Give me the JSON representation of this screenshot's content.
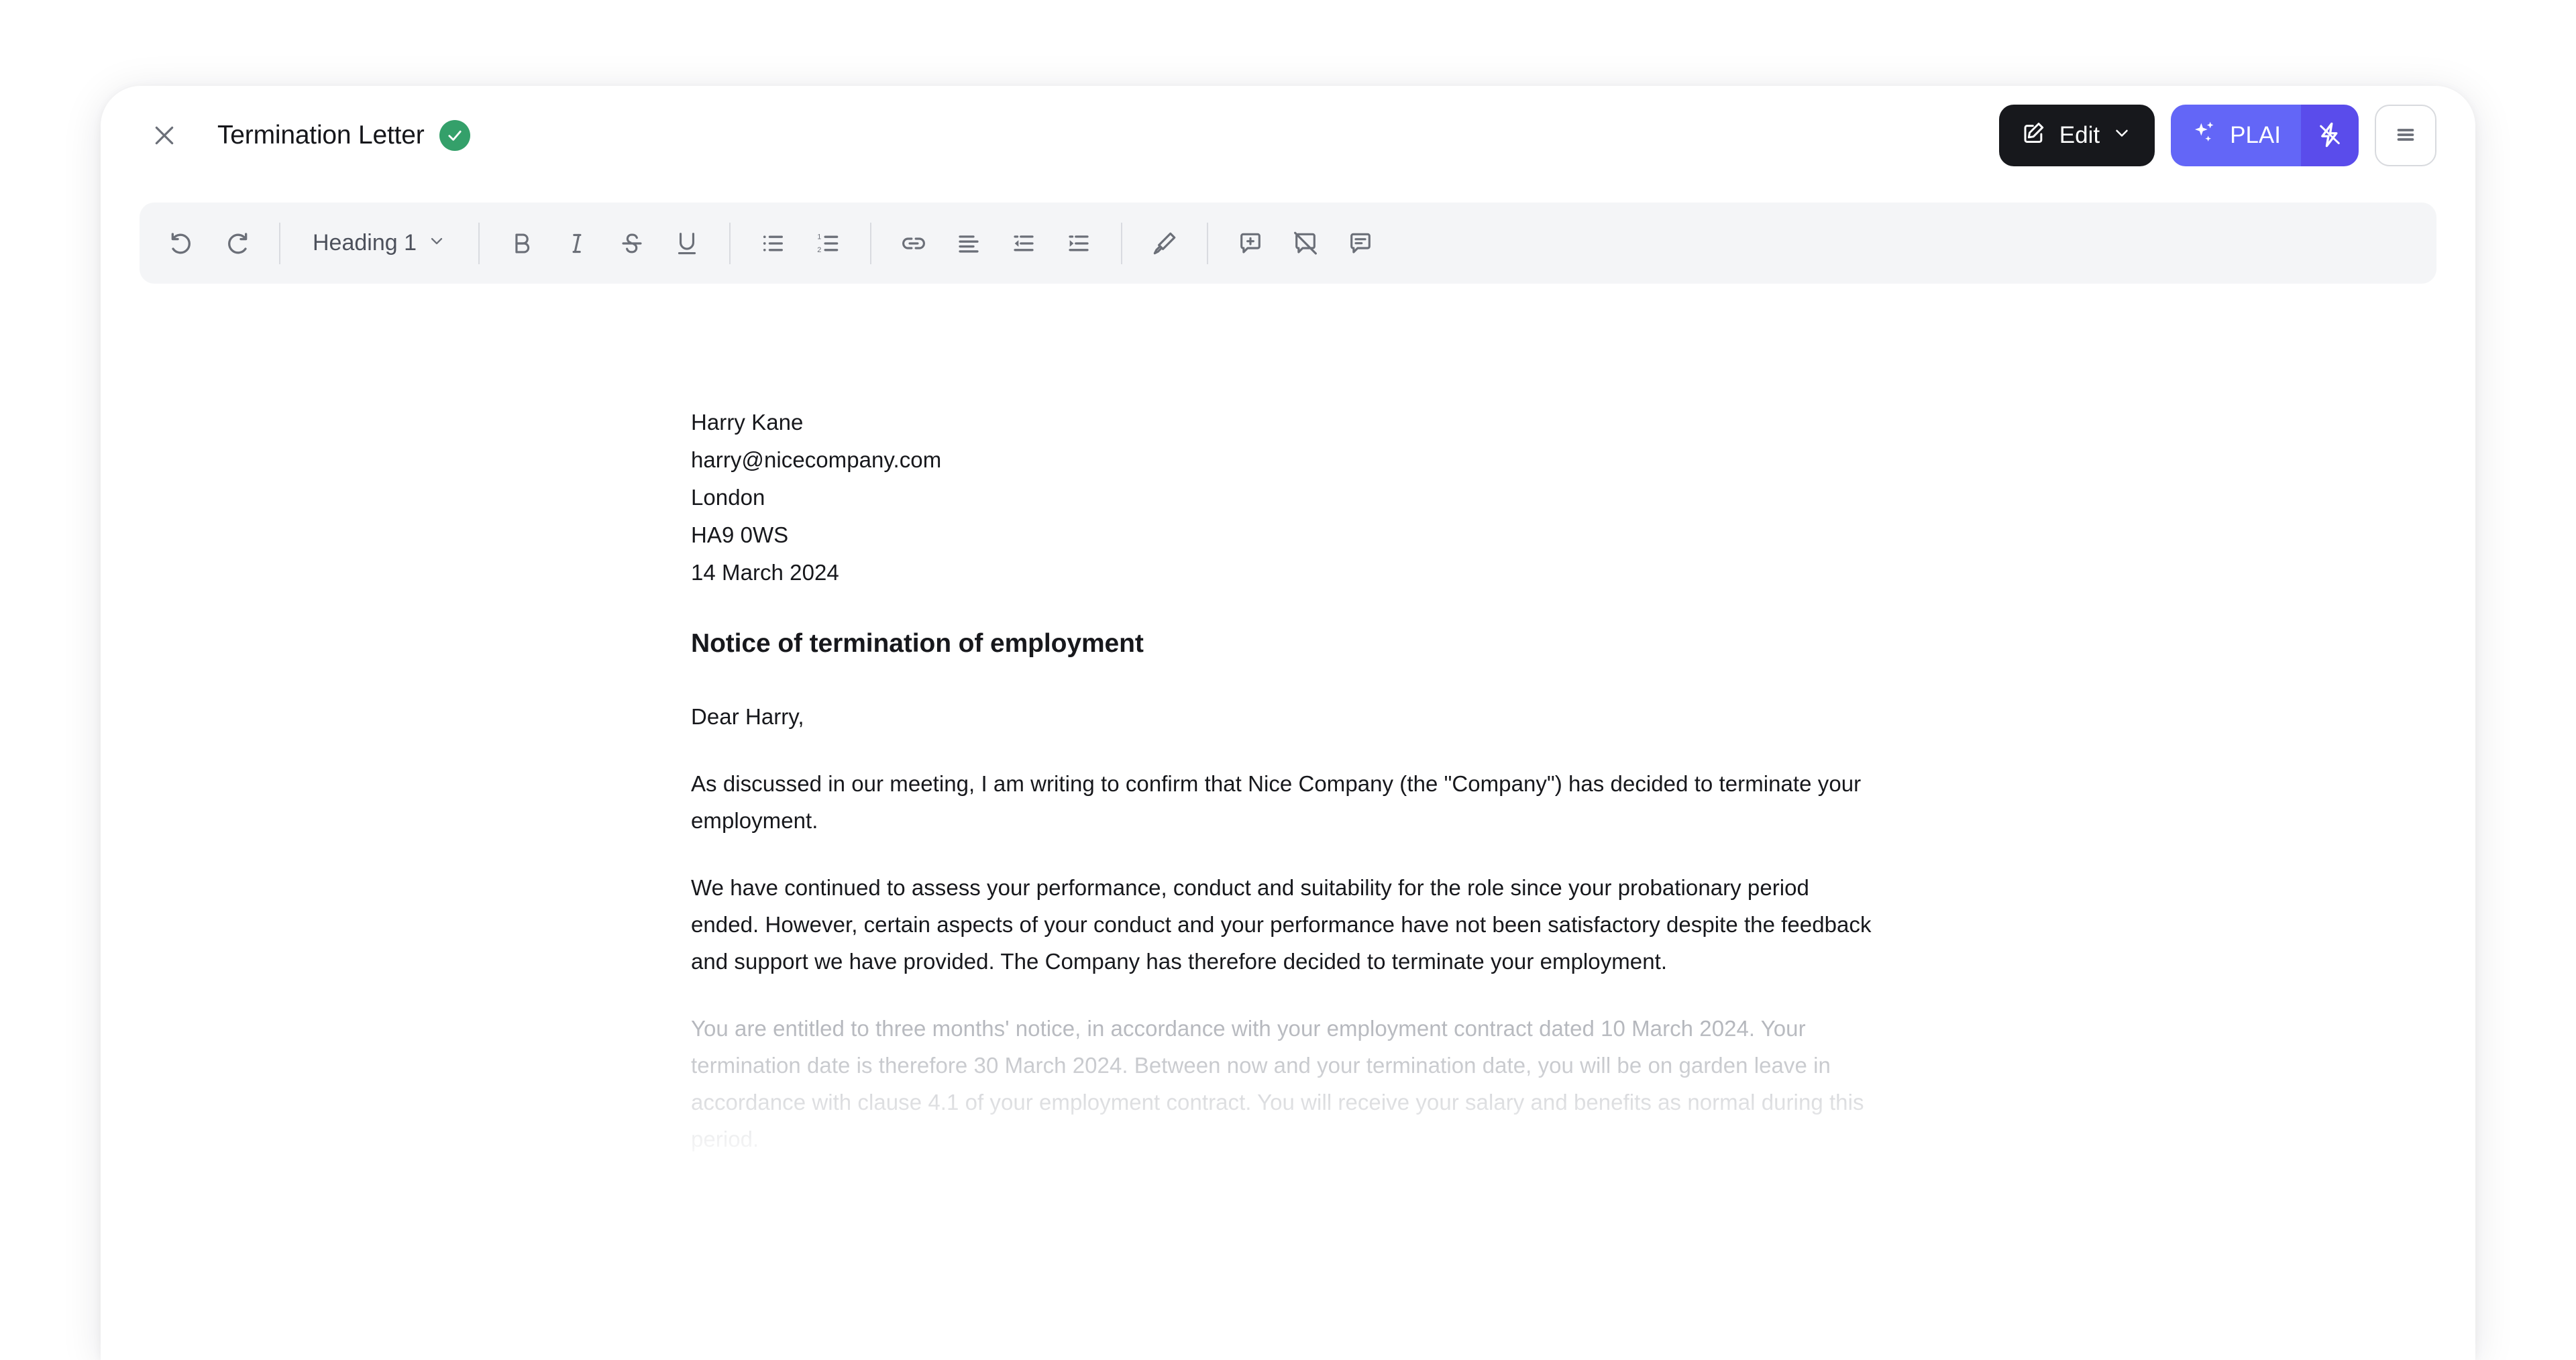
{
  "window": {
    "background_color": "#ffffff",
    "card_background": "#ffffff"
  },
  "header": {
    "close_icon": "close-icon",
    "title": "Termination Letter",
    "status_badge": {
      "icon": "check-icon",
      "color": "#34a06a",
      "label": "Saved"
    },
    "actions": {
      "edit": {
        "label": "Edit",
        "icon": "edit-square-pencil-icon",
        "chevron": "chevron-down-icon",
        "background": "#17181c"
      },
      "plai": {
        "label": "PLAI",
        "icon": "sparkles-icon",
        "bolt_icon": "lightning-bolt-icon",
        "background": "#6366f7",
        "bolt_background": "#5a4ceb"
      },
      "menu": {
        "icon": "hamburger-menu-icon",
        "label": "Menu"
      }
    }
  },
  "toolbar": {
    "background": "#f4f5f7",
    "groups": [
      {
        "name": "history",
        "items": [
          {
            "name": "undo-button",
            "icon": "undo-icon",
            "label": "Undo"
          },
          {
            "name": "redo-button",
            "icon": "redo-icon",
            "label": "Redo"
          }
        ]
      },
      {
        "name": "block-style",
        "items": [
          {
            "name": "text-style-select",
            "icon": "chevron-down-icon",
            "label": "Heading 1"
          }
        ]
      },
      {
        "name": "inline-format",
        "items": [
          {
            "name": "bold-button",
            "icon": "bold-icon",
            "label": "B"
          },
          {
            "name": "italic-button",
            "icon": "italic-icon",
            "label": "I"
          },
          {
            "name": "strikethrough-button",
            "icon": "strikethrough-icon",
            "label": "S"
          },
          {
            "name": "underline-button",
            "icon": "underline-icon",
            "label": "U"
          }
        ]
      },
      {
        "name": "lists",
        "items": [
          {
            "name": "bulleted-list-button",
            "icon": "bulleted-list-icon",
            "label": "Bulleted list"
          },
          {
            "name": "numbered-list-button",
            "icon": "numbered-list-icon",
            "label": "Numbered list"
          }
        ]
      },
      {
        "name": "insert-align",
        "items": [
          {
            "name": "link-button",
            "icon": "link-icon",
            "label": "Link"
          },
          {
            "name": "align-left-button",
            "icon": "align-left-icon",
            "label": "Align left"
          },
          {
            "name": "outdent-button",
            "icon": "outdent-icon",
            "label": "Decrease indent"
          },
          {
            "name": "indent-button",
            "icon": "indent-icon",
            "label": "Increase indent"
          }
        ]
      },
      {
        "name": "highlight",
        "items": [
          {
            "name": "highlighter-button",
            "icon": "highlighter-pen-icon",
            "label": "Highlight"
          }
        ]
      },
      {
        "name": "comments",
        "items": [
          {
            "name": "add-comment-button",
            "icon": "comment-plus-icon",
            "label": "Add comment"
          },
          {
            "name": "hide-comments-button",
            "icon": "comment-off-icon",
            "label": "Hide comments"
          },
          {
            "name": "show-comments-button",
            "icon": "comment-lines-icon",
            "label": "Show comments"
          }
        ]
      }
    ]
  },
  "document": {
    "address_lines": [
      "Harry Kane",
      "harry@nicecompany.com",
      "London",
      "HA9 0WS",
      "14 March 2024"
    ],
    "heading": "Notice of termination of employment",
    "salutation": "Dear Harry,",
    "paragraphs": [
      "As discussed in our meeting, I am writing to confirm that Nice Company (the \"Company\") has decided to terminate your employment.",
      "We have continued to assess your performance, conduct and suitability for the role since your probationary period ended. However, certain aspects of your conduct and your performance have not been satisfactory despite the feedback and support we have provided. The Company has therefore decided to terminate your employment."
    ],
    "faded_paragraph": "You are entitled to three months' notice, in accordance with your employment contract dated 10 March 2024. Your termination date is therefore 30 March 2024. Between now and your termination date, you will be on garden leave in accordance with clause 4.1 of your employment contract. You will receive your salary and benefits as normal during this period."
  }
}
